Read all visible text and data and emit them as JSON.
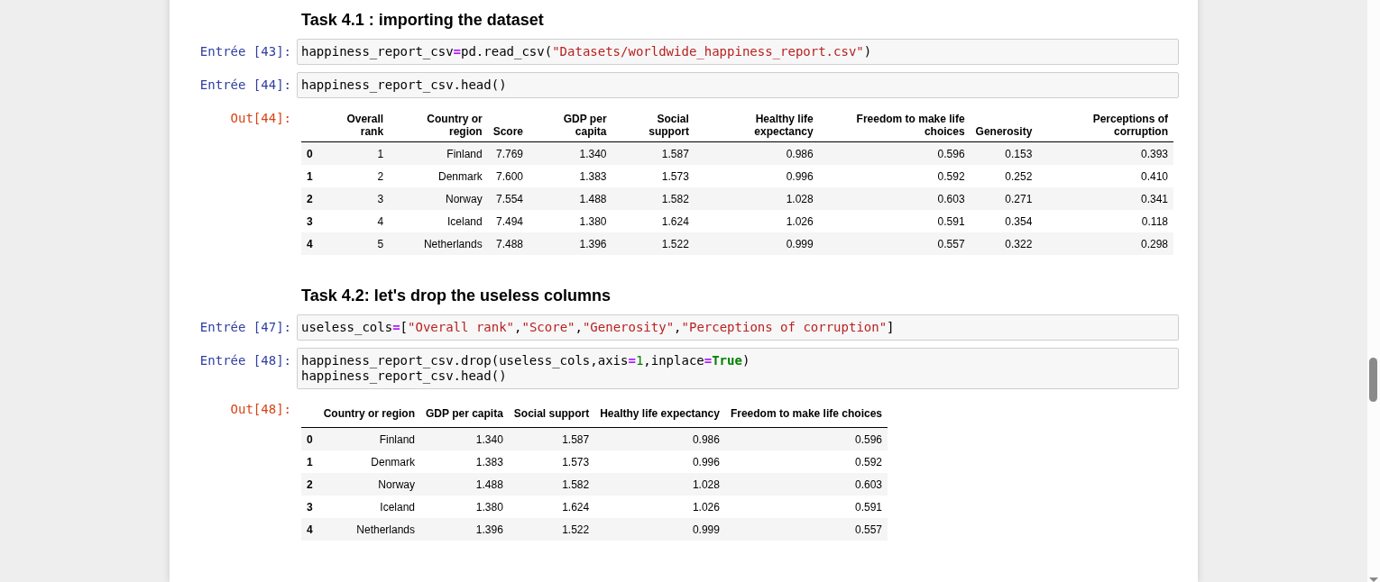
{
  "cells": [
    {
      "kind": "heading",
      "text": "Task 4.1 : importing the dataset"
    },
    {
      "kind": "code",
      "prompt": "Entrée [43]:",
      "lines": [
        [
          {
            "t": "happiness_report_csv",
            "kind": "plain"
          },
          {
            "t": "=",
            "kind": "op"
          },
          {
            "t": "pd.read_csv(",
            "kind": "plain"
          },
          {
            "t": "\"Datasets/worldwide_happiness_report.csv\"",
            "kind": "string"
          },
          {
            "t": ")",
            "kind": "plain"
          }
        ]
      ]
    },
    {
      "kind": "code",
      "prompt": "Entrée [44]:",
      "lines": [
        [
          {
            "t": "happiness_report_csv.head()",
            "kind": "plain"
          }
        ]
      ]
    },
    {
      "kind": "output",
      "prompt": "Out[44]:",
      "wide": true,
      "columns": [
        "Overall rank",
        "Country or region",
        "Score",
        "GDP per capita",
        "Social support",
        "Healthy life expectancy",
        "Freedom to make life choices",
        "Generosity",
        "Perceptions of corruption"
      ],
      "rows": [
        {
          "index": "0",
          "cells": [
            "1",
            "Finland",
            "7.769",
            "1.340",
            "1.587",
            "0.986",
            "0.596",
            "0.153",
            "0.393"
          ]
        },
        {
          "index": "1",
          "cells": [
            "2",
            "Denmark",
            "7.600",
            "1.383",
            "1.573",
            "0.996",
            "0.592",
            "0.252",
            "0.410"
          ]
        },
        {
          "index": "2",
          "cells": [
            "3",
            "Norway",
            "7.554",
            "1.488",
            "1.582",
            "1.028",
            "0.603",
            "0.271",
            "0.341"
          ]
        },
        {
          "index": "3",
          "cells": [
            "4",
            "Iceland",
            "7.494",
            "1.380",
            "1.624",
            "1.026",
            "0.591",
            "0.354",
            "0.118"
          ]
        },
        {
          "index": "4",
          "cells": [
            "5",
            "Netherlands",
            "7.488",
            "1.396",
            "1.522",
            "0.999",
            "0.557",
            "0.322",
            "0.298"
          ]
        }
      ]
    },
    {
      "kind": "heading",
      "text": "Task 4.2: let's drop the useless columns"
    },
    {
      "kind": "code",
      "prompt": "Entrée [47]:",
      "lines": [
        [
          {
            "t": "useless_cols",
            "kind": "plain"
          },
          {
            "t": "=",
            "kind": "op"
          },
          {
            "t": "[",
            "kind": "plain"
          },
          {
            "t": "\"Overall rank\"",
            "kind": "string"
          },
          {
            "t": ",",
            "kind": "plain"
          },
          {
            "t": "\"Score\"",
            "kind": "string"
          },
          {
            "t": ",",
            "kind": "plain"
          },
          {
            "t": "\"Generosity\"",
            "kind": "string"
          },
          {
            "t": ",",
            "kind": "plain"
          },
          {
            "t": "\"Perceptions of corruption\"",
            "kind": "string"
          },
          {
            "t": "]",
            "kind": "plain"
          }
        ]
      ]
    },
    {
      "kind": "code",
      "prompt": "Entrée [48]:",
      "lines": [
        [
          {
            "t": "happiness_report_csv.drop(useless_cols,axis",
            "kind": "plain"
          },
          {
            "t": "=",
            "kind": "op"
          },
          {
            "t": "1",
            "kind": "number"
          },
          {
            "t": ",inplace",
            "kind": "plain"
          },
          {
            "t": "=",
            "kind": "op"
          },
          {
            "t": "True",
            "kind": "keyword"
          },
          {
            "t": ")",
            "kind": "plain"
          }
        ],
        [
          {
            "t": "happiness_report_csv.head()",
            "kind": "plain"
          }
        ]
      ]
    },
    {
      "kind": "output",
      "prompt": "Out[48]:",
      "wide": false,
      "columns": [
        "Country or region",
        "GDP per capita",
        "Social support",
        "Healthy life expectancy",
        "Freedom to make life choices"
      ],
      "rows": [
        {
          "index": "0",
          "cells": [
            "Finland",
            "1.340",
            "1.587",
            "0.986",
            "0.596"
          ]
        },
        {
          "index": "1",
          "cells": [
            "Denmark",
            "1.383",
            "1.573",
            "0.996",
            "0.592"
          ]
        },
        {
          "index": "2",
          "cells": [
            "Norway",
            "1.488",
            "1.582",
            "1.028",
            "0.603"
          ]
        },
        {
          "index": "3",
          "cells": [
            "Iceland",
            "1.380",
            "1.624",
            "1.026",
            "0.591"
          ]
        },
        {
          "index": "4",
          "cells": [
            "Netherlands",
            "1.396",
            "1.522",
            "0.999",
            "0.557"
          ]
        }
      ]
    }
  ]
}
